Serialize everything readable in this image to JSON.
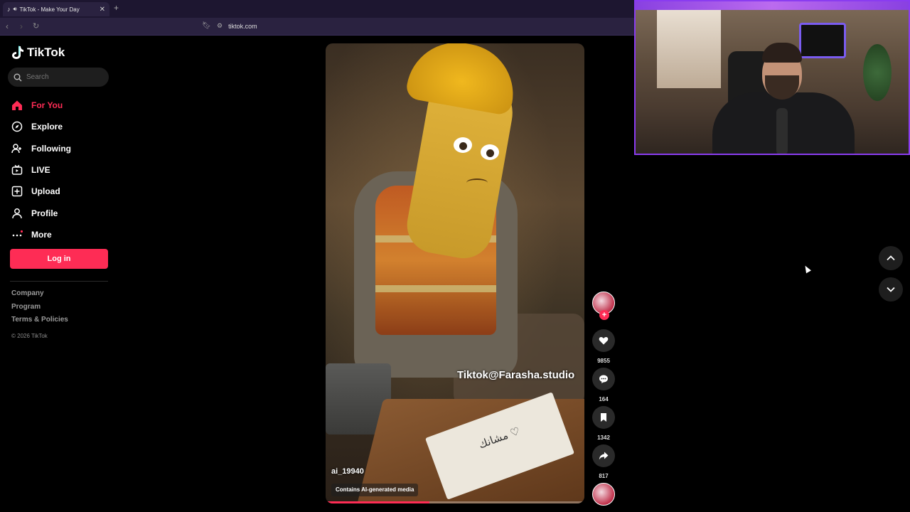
{
  "browser": {
    "tab_title": "TikTok - Make Your Day",
    "tab_close": "✕",
    "new_tab": "+",
    "url": "tiktok.com",
    "icons": [
      "back-icon",
      "forward-icon",
      "reload-icon",
      "bookmark-icon",
      "site-info-icon"
    ]
  },
  "sidebar": {
    "logo_text": "TikTok",
    "search_placeholder": "Search",
    "items": [
      {
        "label": "For You",
        "icon": "home-icon",
        "active": true
      },
      {
        "label": "Explore",
        "icon": "compass-icon",
        "active": false
      },
      {
        "label": "Following",
        "icon": "user-plus-icon",
        "active": false
      },
      {
        "label": "LIVE",
        "icon": "live-tv-icon",
        "active": false
      },
      {
        "label": "Upload",
        "icon": "plus-square-icon",
        "active": false
      },
      {
        "label": "Profile",
        "icon": "user-icon",
        "active": false
      },
      {
        "label": "More",
        "icon": "more-icon",
        "active": false
      }
    ],
    "login_label": "Log in",
    "footer_links": [
      "Company",
      "Program",
      "Terms & Policies"
    ],
    "copyright": "© 2026 TikTok"
  },
  "video": {
    "watermark": "Tiktok@Farasha.studio",
    "letter_text": "مشانك ♡",
    "author": "ai_19940",
    "ai_label": "Contains AI-generated media",
    "progress": 0.4
  },
  "actions": {
    "likes": "9855",
    "comments": "164",
    "saves": "1342",
    "shares": "817",
    "follow_plus": "+"
  },
  "colors": {
    "accent": "#fe2c55",
    "browser_bg": "#2a2240",
    "stream_border": "#8a3cf0"
  }
}
